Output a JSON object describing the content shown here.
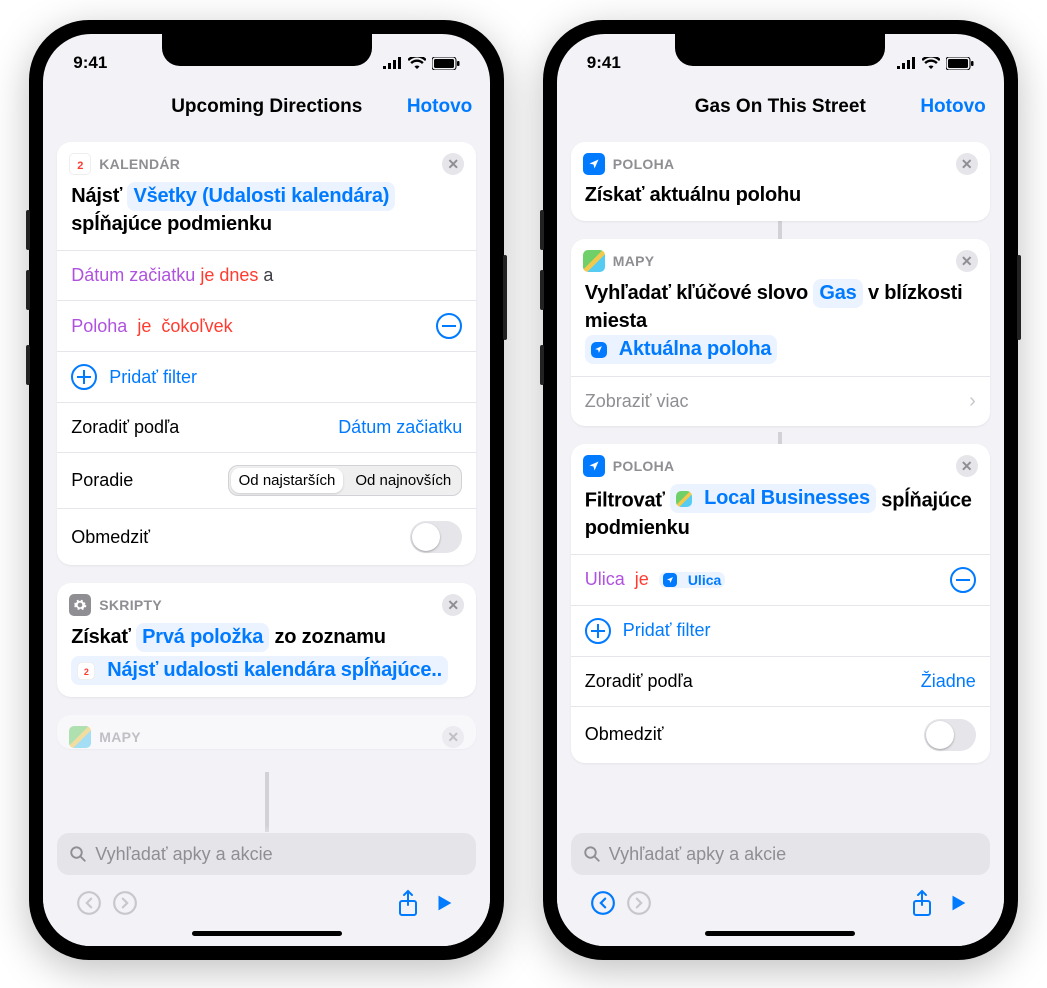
{
  "status": {
    "time": "9:41"
  },
  "left": {
    "nav": {
      "title": "Upcoming Directions",
      "done": "Hotovo"
    },
    "card1": {
      "app": "KALENDÁR",
      "t1": "Nájsť",
      "pill": "Všetky (Udalosti kalendára)",
      "t2": "spĺňajúce podmienku",
      "f1_a": "Dátum začiatku",
      "f1_b": "je dnes",
      "f1_c": "a",
      "f2_a": "Poloha",
      "f2_b": "je",
      "f2_c": "čokoľvek",
      "add": "Pridať filter",
      "sort_l": "Zoradiť podľa",
      "sort_v": "Dátum začiatku",
      "order_l": "Poradie",
      "order_a": "Od najstarších",
      "order_b": "Od najnovších",
      "limit_l": "Obmedziť"
    },
    "card2": {
      "app": "SKRIPTY",
      "t1": "Získať",
      "pill1": "Prvá položka",
      "t2": "zo zoznamu",
      "pill2": "Nájsť udalosti kalendára spĺňajúce.."
    },
    "card3": {
      "app": "MAPY"
    },
    "search": "Vyhľadať apky a akcie"
  },
  "right": {
    "nav": {
      "title": "Gas On This Street",
      "done": "Hotovo"
    },
    "card1": {
      "app": "POLOHA",
      "t": "Získať aktuálnu polohu"
    },
    "card2": {
      "app": "MAPY",
      "t1": "Vyhľadať kľúčové slovo",
      "pill1": "Gas",
      "t2": "v blízkosti miesta",
      "pill2": "Aktuálna poloha",
      "more": "Zobraziť viac"
    },
    "card3": {
      "app": "POLOHA",
      "t1": "Filtrovať",
      "pill": "Local Businesses",
      "t2": "spĺňajúce podmienku",
      "f_a": "Ulica",
      "f_b": "je",
      "f_chip": "Ulica",
      "add": "Pridať filter",
      "sort_l": "Zoradiť podľa",
      "sort_v": "Žiadne",
      "limit_l": "Obmedziť"
    },
    "search": "Vyhľadať apky a akcie"
  }
}
